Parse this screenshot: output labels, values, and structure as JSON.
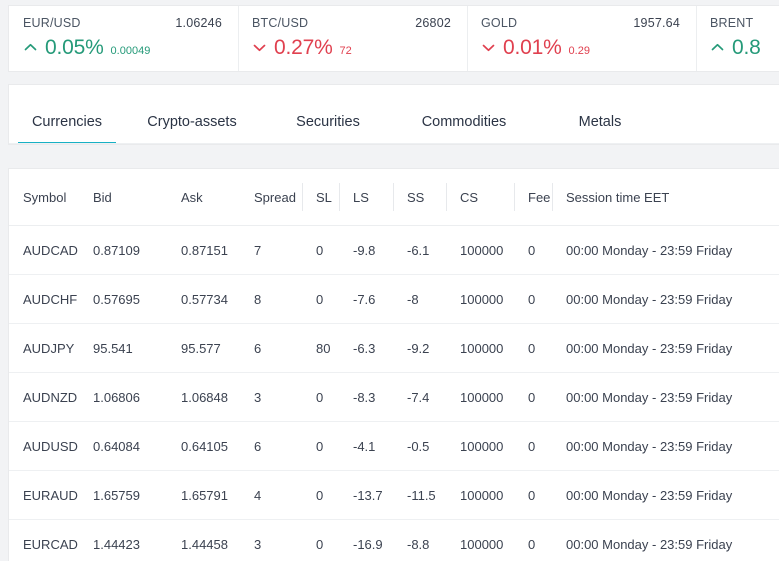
{
  "ticker": {
    "items": [
      {
        "symbol": "EUR/USD",
        "price": "1.06246",
        "direction": "up",
        "percent": "0.05%",
        "delta": "0.00049"
      },
      {
        "symbol": "BTC/USD",
        "price": "26802",
        "direction": "down",
        "percent": "0.27%",
        "delta": "72"
      },
      {
        "symbol": "GOLD",
        "price": "1957.64",
        "direction": "down",
        "percent": "0.01%",
        "delta": "0.29"
      },
      {
        "symbol": "BRENT",
        "price": "",
        "direction": "up",
        "percent": "0.8",
        "delta": ""
      }
    ]
  },
  "tabs": {
    "items": [
      {
        "label": "Currencies",
        "active": true
      },
      {
        "label": "Crypto-assets",
        "active": false
      },
      {
        "label": "Securities",
        "active": false
      },
      {
        "label": "Commodities",
        "active": false
      },
      {
        "label": "Metals",
        "active": false
      }
    ],
    "active_underline_color": "#17b0c4"
  },
  "table": {
    "columns": [
      "Symbol",
      "Bid",
      "Ask",
      "Spread",
      "SL",
      "LS",
      "SS",
      "CS",
      "Fee",
      "Session time EET"
    ],
    "rows": [
      {
        "symbol": "AUDCAD",
        "bid": "0.87109",
        "ask": "0.87151",
        "spread": "7",
        "sl": "0",
        "ls": "-9.8",
        "ss": "-6.1",
        "cs": "100000",
        "fee": "0",
        "session": "00:00 Monday - 23:59 Friday"
      },
      {
        "symbol": "AUDCHF",
        "bid": "0.57695",
        "ask": "0.57734",
        "spread": "8",
        "sl": "0",
        "ls": "-7.6",
        "ss": "-8",
        "cs": "100000",
        "fee": "0",
        "session": "00:00 Monday - 23:59 Friday"
      },
      {
        "symbol": "AUDJPY",
        "bid": "95.541",
        "ask": "95.577",
        "spread": "6",
        "sl": "80",
        "ls": "-6.3",
        "ss": "-9.2",
        "cs": "100000",
        "fee": "0",
        "session": "00:00 Monday - 23:59 Friday"
      },
      {
        "symbol": "AUDNZD",
        "bid": "1.06806",
        "ask": "1.06848",
        "spread": "3",
        "sl": "0",
        "ls": "-8.3",
        "ss": "-7.4",
        "cs": "100000",
        "fee": "0",
        "session": "00:00 Monday - 23:59 Friday"
      },
      {
        "symbol": "AUDUSD",
        "bid": "0.64084",
        "ask": "0.64105",
        "spread": "6",
        "sl": "0",
        "ls": "-4.1",
        "ss": "-0.5",
        "cs": "100000",
        "fee": "0",
        "session": "00:00 Monday - 23:59 Friday"
      },
      {
        "symbol": "EURAUD",
        "bid": "1.65759",
        "ask": "1.65791",
        "spread": "4",
        "sl": "0",
        "ls": "-13.7",
        "ss": "-11.5",
        "cs": "100000",
        "fee": "0",
        "session": "00:00 Monday - 23:59 Friday"
      },
      {
        "symbol": "EURCAD",
        "bid": "1.44423",
        "ask": "1.44458",
        "spread": "3",
        "sl": "0",
        "ls": "-16.9",
        "ss": "-8.8",
        "cs": "100000",
        "fee": "0",
        "session": "00:00 Monday - 23:59 Friday"
      }
    ]
  },
  "colors": {
    "up": "#259a79",
    "down": "#e0404f",
    "accent": "#17b0c4",
    "page_background": "#f2f3f5",
    "card_background": "#ffffff",
    "text": "#3b4250"
  }
}
